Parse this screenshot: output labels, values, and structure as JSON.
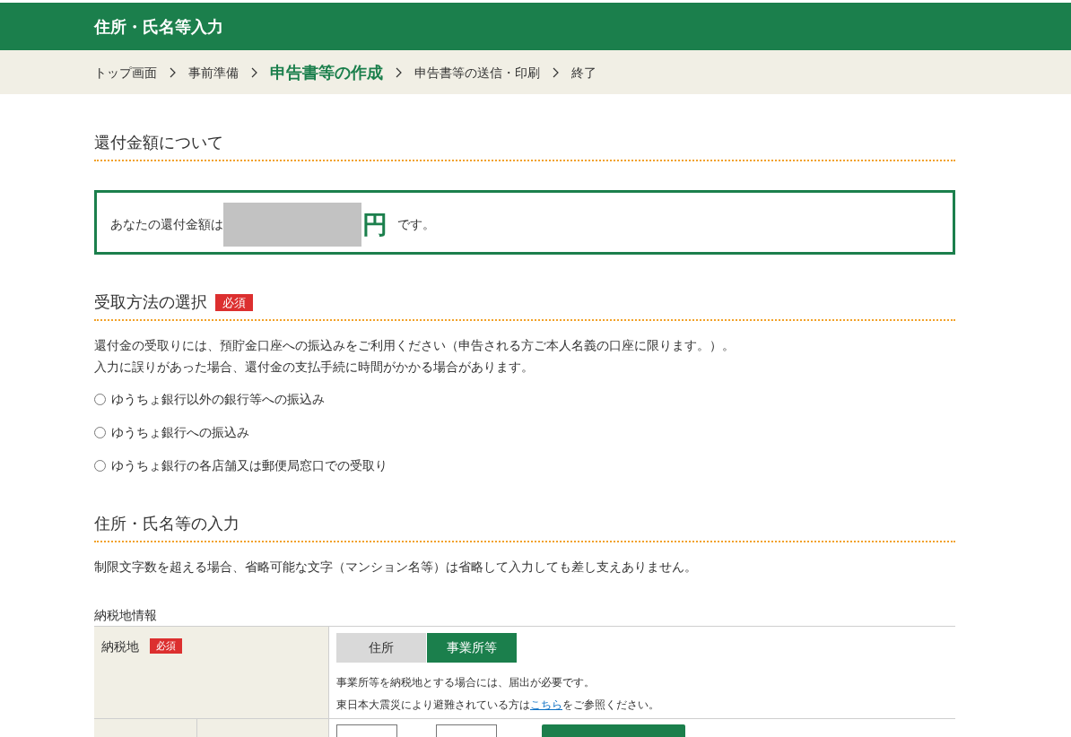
{
  "header": {
    "title": "住所・氏名等入力"
  },
  "breadcrumb": [
    {
      "label": "トップ画面",
      "current": false
    },
    {
      "label": "事前準備",
      "current": false
    },
    {
      "label": "申告書等の作成",
      "current": true
    },
    {
      "label": "申告書等の送信・印刷",
      "current": false
    },
    {
      "label": "終了",
      "current": false
    }
  ],
  "refund": {
    "heading": "還付金額について",
    "label": "あなたの還付金額は",
    "unit": "円",
    "suffix": "です。"
  },
  "receipt_method": {
    "heading": "受取方法の選択",
    "badge": "必須",
    "paragraphs": [
      "還付金の受取りには、預貯金口座への振込みをご利用ください（申告される方ご本人名義の口座に限ります。）。",
      "入力に誤りがあった場合、還付金の支払手続に時間がかかる場合があります。"
    ],
    "options": [
      {
        "label": "ゆうちょ銀行以外の銀行等への振込み",
        "selected": false
      },
      {
        "label": "ゆうちょ銀行への振込み",
        "selected": false
      },
      {
        "label": "ゆうちょ銀行の各店舗又は郵便局窓口での受取り",
        "selected": false
      }
    ]
  },
  "address": {
    "heading": "住所・氏名等の入力",
    "note": "制限文字数を超える場合、省略可能な文字（マンション名等）は省略して入力しても差し支えありません。",
    "table_caption": "納税地情報",
    "tax_place": {
      "label": "納税地",
      "badge": "必須",
      "options": [
        {
          "label": "住所",
          "selected": false
        },
        {
          "label": "事業所等",
          "selected": true
        }
      ],
      "notes": [
        {
          "text": "事業所等を納税地とする場合には、届出が必要です。"
        },
        {
          "text": "東日本大震災により避難されている方は",
          "link": "こちら",
          "text_after": "をご参照ください。"
        }
      ]
    }
  }
}
